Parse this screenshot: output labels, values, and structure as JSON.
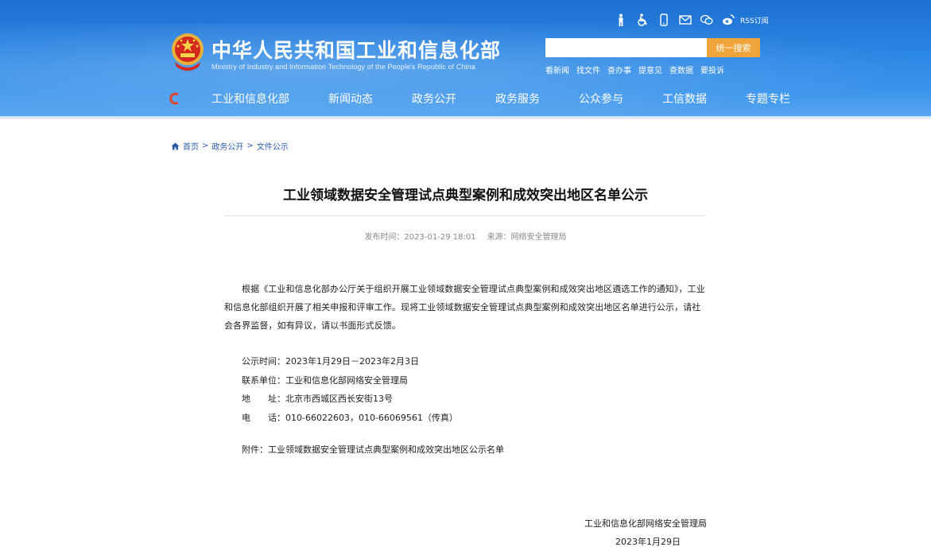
{
  "header": {
    "site_title": "中华人民共和国工业和信息化部",
    "site_subtitle": "Ministry of Industry and Information Technology of the People's Republic of China",
    "top_icons": [
      "accessibility-elder-icon",
      "wheelchair-icon",
      "mobile-icon",
      "mail-icon",
      "wechat-icon",
      "weibo-icon"
    ],
    "rss_label": "RSS订阅",
    "search": {
      "placeholder": "",
      "button_label": "统一搜索"
    },
    "quick_links": [
      "看新闻",
      "找文件",
      "查办事",
      "提意见",
      "查数据",
      "要投诉"
    ],
    "nav": [
      "工业和信息化部",
      "新闻动态",
      "政务公开",
      "政务服务",
      "公众参与",
      "工信数据",
      "专题专栏"
    ]
  },
  "breadcrumb": {
    "items": [
      "首页",
      "政务公开",
      "文件公示"
    ],
    "separator": ">"
  },
  "article": {
    "title": "工业领域数据安全管理试点典型案例和成效突出地区名单公示",
    "publish_time": "发布时间：2023-01-29 18:01",
    "source": "来源：网络安全管理局",
    "paragraph": "根据《工业和信息化部办公厅关于组织开展工业领域数据安全管理试点典型案例和成效突出地区遴选工作的通知》，工业和信息化部组织开展了相关申报和评审工作。现将工业领域数据安全管理试点典型案例和成效突出地区名单进行公示，请社会各界监督，如有异议，请以书面形式反馈。",
    "info": [
      "公示时间：2023年1月29日－2023年2月3日",
      "联系单位：工业和信息化部网络安全管理局",
      "地　　址：北京市西城区西长安街13号",
      "电　　话：010-66022603，010-66069561（传真）"
    ],
    "attachment": "附件：工业领域数据安全管理试点典型案例和成效突出地区公示名单",
    "signature_org": "工业和信息化部网络安全管理局",
    "signature_date": "2023年1月29日"
  },
  "colors": {
    "header_blue": "#2a86e4",
    "search_button": "#f0a53a",
    "link_blue": "#2a5caa"
  }
}
